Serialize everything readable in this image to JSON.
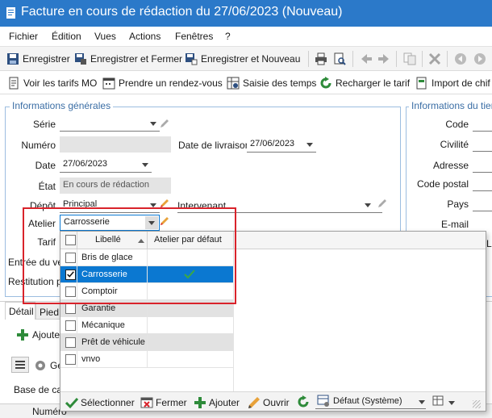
{
  "window": {
    "title": "Facture en cours de rédaction du 27/06/2023 (Nouveau)"
  },
  "menu": [
    "Fichier",
    "Édition",
    "Vues",
    "Actions",
    "Fenêtres",
    "?"
  ],
  "toolbar1": {
    "save": "Enregistrer",
    "save_close": "Enregistrer et Fermer",
    "save_new": "Enregistrer et Nouveau"
  },
  "toolbar2": {
    "tarifs_mo": "Voir les tarifs MO",
    "rdv": "Prendre un rendez-vous",
    "saisie_temps": "Saisie des temps",
    "recharger": "Recharger le tarif",
    "import": "Import de chif"
  },
  "general": {
    "legend": "Informations générales",
    "serie_label": "Série",
    "numero_label": "Numéro",
    "livraison_label": "Date de livraison",
    "livraison_value": "27/06/2023",
    "date_label": "Date",
    "date_value": "27/06/2023",
    "etat_label": "État",
    "etat_value": "En cours de rédaction",
    "depot_label": "Dépôt",
    "depot_value": "Principal",
    "intervenant_label": "Intervenant",
    "atelier_label": "Atelier",
    "atelier_value": "Carrosserie",
    "tarif_label": "Tarif",
    "entree_label": "Entrée du véh",
    "restitution_label": "Restitution pr"
  },
  "tiers": {
    "legend": "Informations du tiers",
    "fields": [
      "Code",
      "Civilité",
      "Adresse",
      "Code postal",
      "Pays",
      "E-mail"
    ],
    "truncated": "Le"
  },
  "tabs": {
    "detail": "Détail",
    "pied": "Pied"
  },
  "bottom": {
    "ajouter": "Ajoute",
    "ge": "Ge",
    "base": "Base de cal",
    "numero": "Numéro"
  },
  "dropdown": {
    "col_libelle": "Libellé",
    "col_defaut": "Atelier par défaut",
    "rows": [
      {
        "label": "Bris de glace",
        "checked": false,
        "default": false,
        "shaded": false,
        "selected": false
      },
      {
        "label": "Carrosserie",
        "checked": true,
        "default": true,
        "shaded": false,
        "selected": true
      },
      {
        "label": "Comptoir",
        "checked": false,
        "default": false,
        "shaded": false,
        "selected": false
      },
      {
        "label": "Garantie",
        "checked": false,
        "default": false,
        "shaded": true,
        "selected": false
      },
      {
        "label": "Mécanique",
        "checked": false,
        "default": false,
        "shaded": false,
        "selected": false
      },
      {
        "label": "Prêt de véhicule",
        "checked": false,
        "default": false,
        "shaded": true,
        "selected": false
      },
      {
        "label": "vnvo",
        "checked": false,
        "default": false,
        "shaded": false,
        "selected": false
      }
    ],
    "footer": {
      "select": "Sélectionner",
      "close": "Fermer",
      "add": "Ajouter",
      "open": "Ouvrir",
      "view": "Défaut (Système)"
    }
  },
  "colors": {
    "title_bar": "#2b79c9",
    "selection": "#0b78d1",
    "highlight_box": "#d9232b",
    "group_border": "#9cbde0"
  }
}
